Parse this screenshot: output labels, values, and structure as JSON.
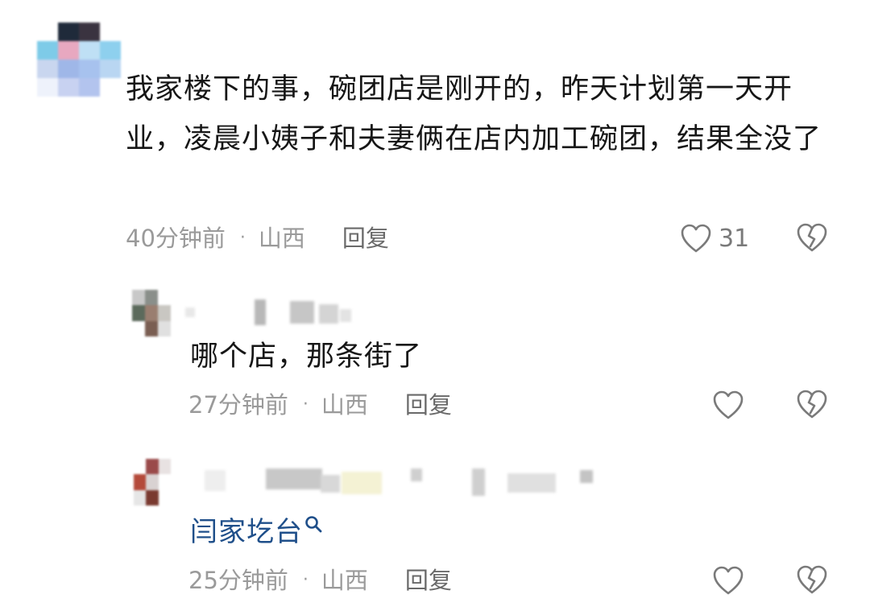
{
  "comments": [
    {
      "text": "我家楼下的事，碗团店是刚开的，昨天计划第一天开业，凌晨小姨子和夫妻俩在店内加工碗团，结果全没了",
      "time": "40分钟前",
      "region": "山西",
      "reply": "回复",
      "likes": "31"
    },
    {
      "text": "哪个店，那条街了",
      "time": "27分钟前",
      "region": "山西",
      "reply": "回复"
    },
    {
      "link_text": "闫家圪台",
      "time": "25分钟前",
      "region": "山西",
      "reply": "回复"
    }
  ],
  "separator": "·",
  "icons": {
    "like": "heart-outline-icon",
    "dislike": "broken-heart-icon",
    "search": "search-icon"
  },
  "colors": {
    "text": "#161616",
    "meta": "#9a9a9a",
    "link": "#1f4f8a"
  }
}
